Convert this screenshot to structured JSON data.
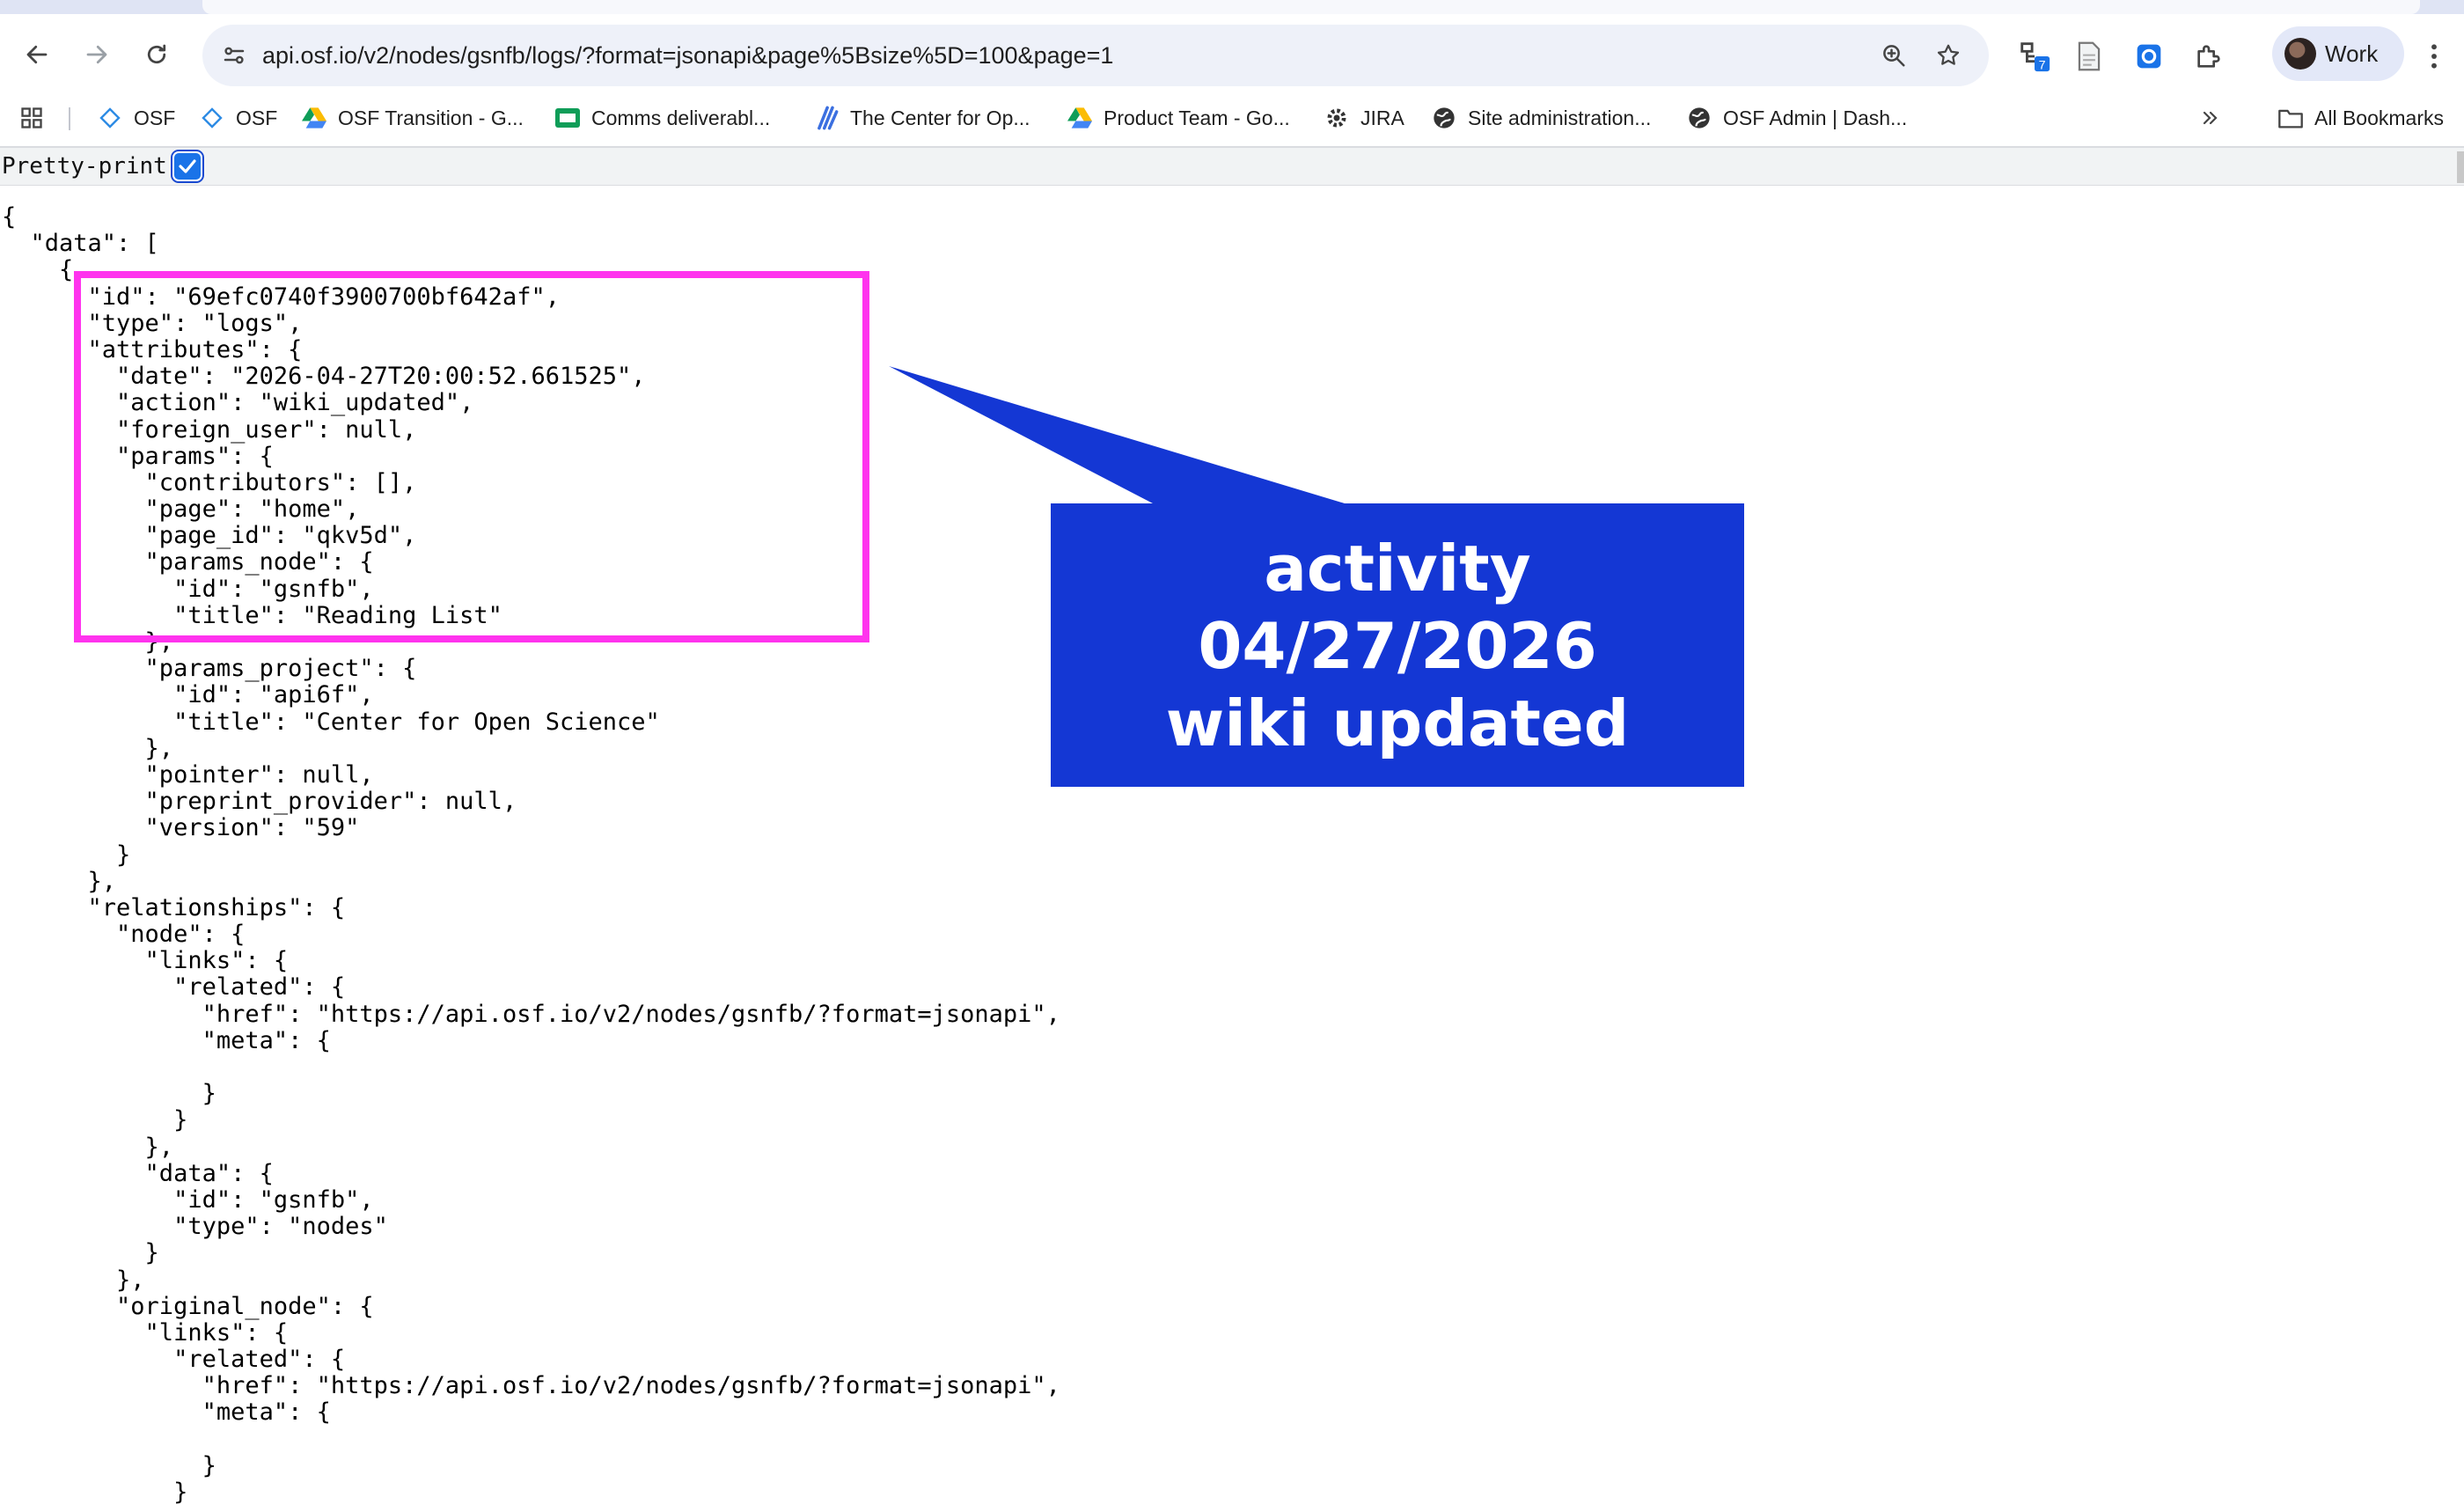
{
  "browser": {
    "url": "api.osf.io/v2/nodes/gsnfb/logs/?format=jsonapi&page%5Bsize%5D=100&page=1",
    "profile_label": "Work",
    "extension_badge": "7",
    "bookmarks": [
      {
        "label": "OSF",
        "icon": "osf-diamond-icon"
      },
      {
        "label": "OSF",
        "icon": "osf-diamond-icon"
      },
      {
        "label": "OSF Transition - G...",
        "icon": "google-drive-icon"
      },
      {
        "label": "Comms deliverabl...",
        "icon": "google-sheets-icon"
      },
      {
        "label": "The Center for Op...",
        "icon": "cos-logo-icon"
      },
      {
        "label": "Product Team - Go...",
        "icon": "google-drive-icon"
      },
      {
        "label": "JIRA",
        "icon": "jira-gear-icon"
      },
      {
        "label": "Site administration...",
        "icon": "globe-icon"
      },
      {
        "label": "OSF Admin | Dash...",
        "icon": "globe-icon"
      }
    ],
    "all_bookmarks_label": "All Bookmarks"
  },
  "page": {
    "pretty_print_label": "Pretty-print",
    "pretty_print_checked": true,
    "json_lines": [
      "{",
      "  \"data\": [",
      "    {",
      "      \"id\": \"69efc0740f3900700bf642af\",",
      "      \"type\": \"logs\",",
      "      \"attributes\": {",
      "        \"date\": \"2026-04-27T20:00:52.661525\",",
      "        \"action\": \"wiki_updated\",",
      "        \"foreign_user\": null,",
      "        \"params\": {",
      "          \"contributors\": [],",
      "          \"page\": \"home\",",
      "          \"page_id\": \"qkv5d\",",
      "          \"params_node\": {",
      "            \"id\": \"gsnfb\",",
      "            \"title\": \"Reading List\"",
      "          },",
      "          \"params_project\": {",
      "            \"id\": \"api6f\",",
      "            \"title\": \"Center for Open Science\"",
      "          },",
      "          \"pointer\": null,",
      "          \"preprint_provider\": null,",
      "          \"version\": \"59\"",
      "        }",
      "      },",
      "      \"relationships\": {",
      "        \"node\": {",
      "          \"links\": {",
      "            \"related\": {",
      "              \"href\": \"https://api.osf.io/v2/nodes/gsnfb/?format=jsonapi\",",
      "              \"meta\": {",
      "",
      "              }",
      "            }",
      "          },",
      "          \"data\": {",
      "            \"id\": \"gsnfb\",",
      "            \"type\": \"nodes\"",
      "          }",
      "        },",
      "        \"original_node\": {",
      "          \"links\": {",
      "            \"related\": {",
      "              \"href\": \"https://api.osf.io/v2/nodes/gsnfb/?format=jsonapi\",",
      "              \"meta\": {",
      "",
      "              }",
      "            }"
    ]
  },
  "annotation": {
    "callout_lines": [
      "activity",
      "04/27/2026",
      "wiki updated"
    ],
    "highlight_color": "#ff33ee",
    "callout_color": "#1437d4"
  }
}
